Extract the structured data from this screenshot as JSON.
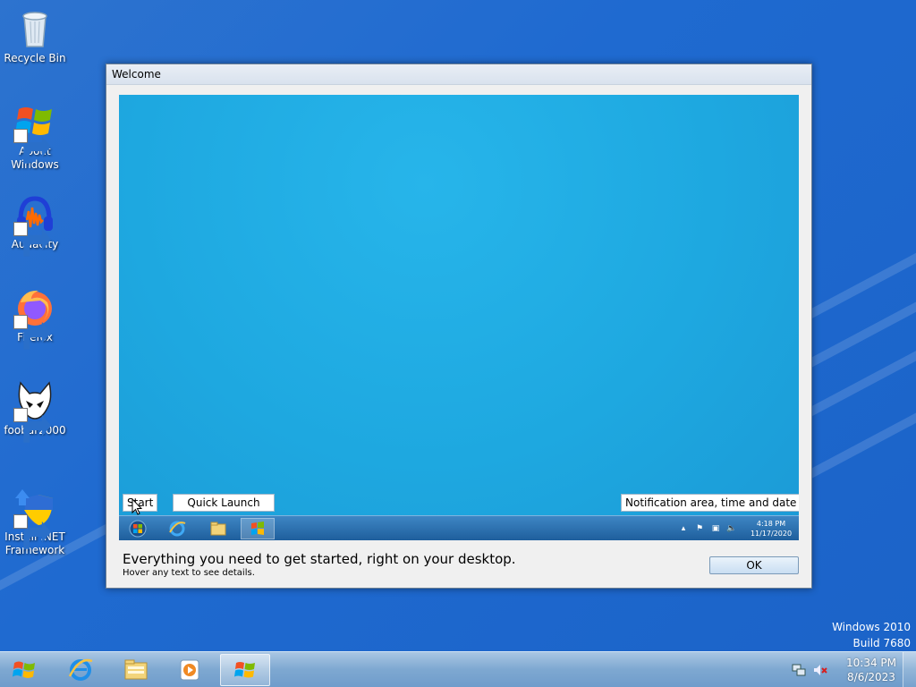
{
  "desktop": {
    "icons": [
      {
        "label": "Recycle Bin",
        "icon": "recycle-bin-icon"
      },
      {
        "label": "About Windows",
        "icon": "windows-flag-icon"
      },
      {
        "label": "Audacity",
        "icon": "audacity-icon"
      },
      {
        "label": "Firefox",
        "icon": "firefox-icon"
      },
      {
        "label": "foobar2000",
        "icon": "foobar2000-icon"
      },
      {
        "label": "Install .NET Framework",
        "icon": "shield-installer-icon"
      }
    ],
    "watermark": {
      "line1": "Windows 2010",
      "line2": "Build 7680"
    }
  },
  "dialog": {
    "title": "Welcome",
    "preview": {
      "hotspots": {
        "start": "Start",
        "quick_launch": "Quick Launch",
        "notification": "Notification area, time and date"
      },
      "mini_clock": {
        "time": "4:18 PM",
        "date": "11/17/2020"
      }
    },
    "heading": "Everything you need to get started, right on your desktop.",
    "hint": "Hover any text to see details.",
    "ok_label": "OK"
  },
  "taskbar": {
    "pinned": [
      "windows-flag-icon",
      "internet-explorer-icon",
      "file-explorer-icon",
      "media-player-icon",
      "windows-flag-icon"
    ],
    "clock": {
      "time": "10:34 PM",
      "date": "8/6/2023"
    }
  },
  "colors": {
    "desktop_bg": "#1f6ad0",
    "preview_bg": "#1ea8e0",
    "taskbar_bg": "#7ea8d1"
  }
}
